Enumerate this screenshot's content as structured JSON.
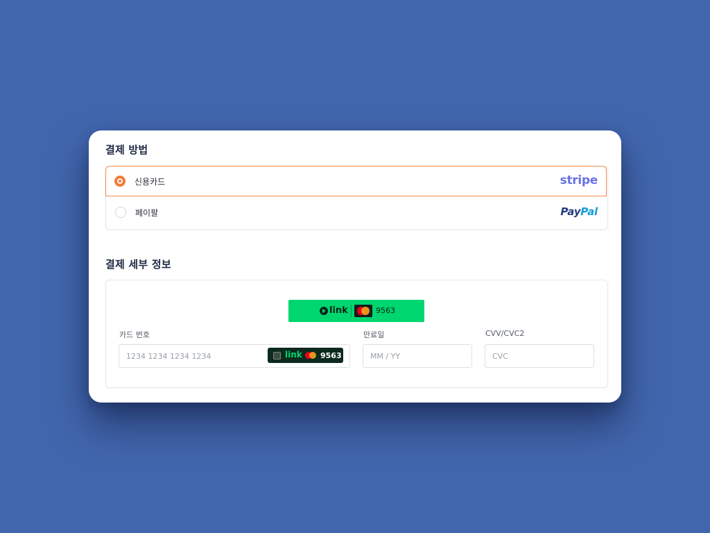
{
  "payment_method": {
    "title": "결제 방법",
    "options": [
      {
        "label": "신용카드",
        "brand": "stripe",
        "selected": true
      },
      {
        "label": "페이팔",
        "brand_part1": "Pay",
        "brand_part2": "Pal",
        "selected": false
      }
    ]
  },
  "payment_details": {
    "title": "결제 세부 정보",
    "link_banner": {
      "word": "link",
      "card_last4": "9563"
    },
    "card_number": {
      "label": "카드 번호",
      "placeholder": "1234 1234 1234 1234"
    },
    "link_chip": {
      "word": "link",
      "card_last4": "9563"
    },
    "expiry": {
      "label": "만료일",
      "placeholder": "MM / YY"
    },
    "cvc": {
      "label": "CVV/CVC2",
      "placeholder": "CVC"
    }
  },
  "icons": {
    "play": "play-circle-icon",
    "mastercard": "mastercard-icon",
    "checkbox": "checkbox-icon"
  },
  "colors": {
    "background": "#4266ad",
    "accent": "#f47b3a",
    "stripe": "#6772e5",
    "paypal_dark": "#253b80",
    "paypal_light": "#179bd7",
    "link_green": "#00d66f",
    "link_dark": "#0c2a1d"
  }
}
